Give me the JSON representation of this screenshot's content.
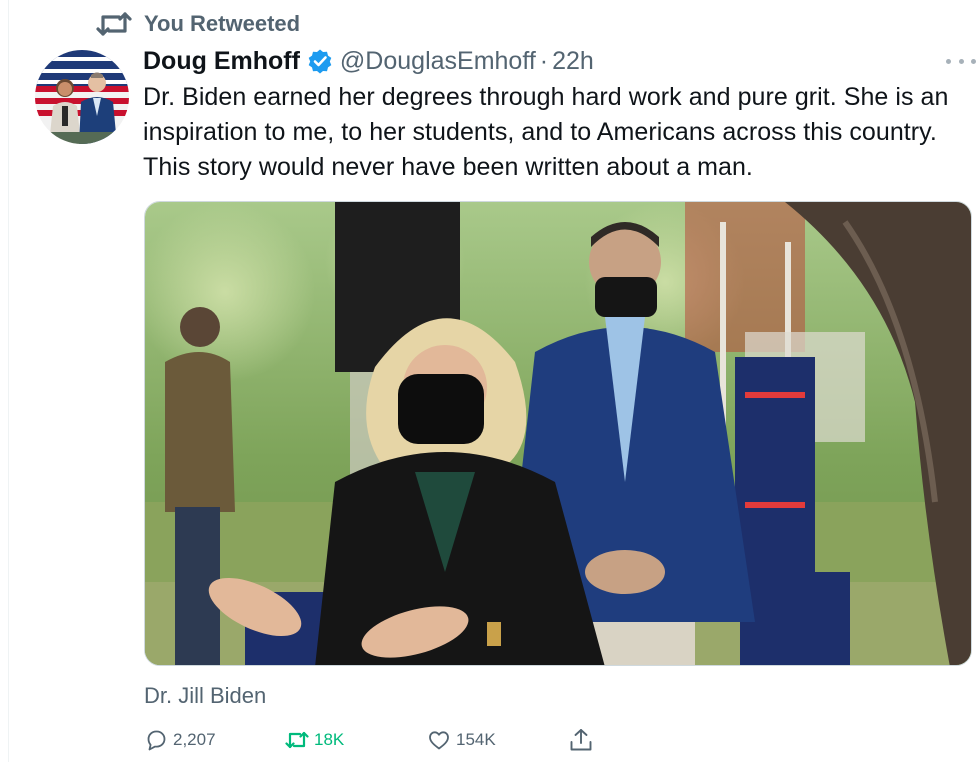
{
  "retweet_context": {
    "label": "You Retweeted"
  },
  "tweet": {
    "display_name": "Doug Emhoff",
    "handle": "@DouglasEmhoff",
    "separator": "·",
    "time": "22h",
    "text_lines": [
      "Dr. Biden earned her degrees through hard work and pure grit. She is an",
      "inspiration to me, to her students, and to Americans across this country.",
      "This story would never have been written about a man."
    ],
    "media": {
      "caption": "Dr. Jill Biden"
    }
  },
  "actions": {
    "reply_count": "2,207",
    "retweet_count": "18K",
    "like_count": "154K"
  },
  "icons": {
    "retweet_context": "retweet-icon",
    "verified": "verified-badge-icon",
    "more": "more-icon",
    "reply": "reply-icon",
    "retweet": "retweet-icon",
    "like": "heart-icon",
    "share": "share-icon"
  },
  "colors": {
    "accent_blue": "#1d9bf0",
    "retweet_green": "#00ba7c",
    "secondary_text": "#536471",
    "primary_text": "#0f1419"
  }
}
